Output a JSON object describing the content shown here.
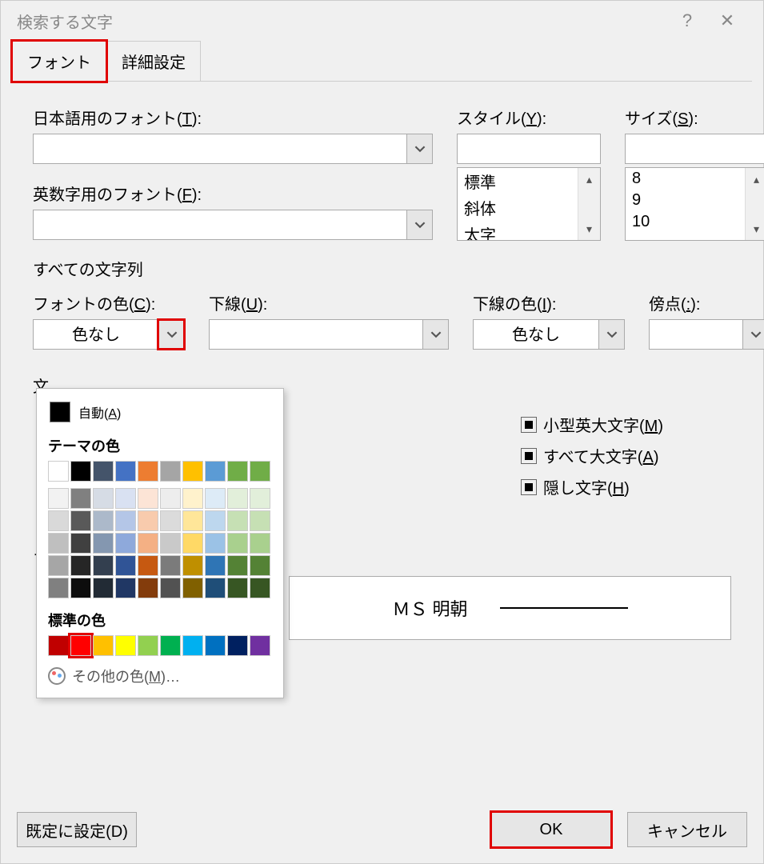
{
  "title": "検索する文字",
  "tabs": {
    "font": "フォント",
    "advanced": "詳細設定"
  },
  "labels": {
    "jp_font": "日本語用のフォント(",
    "jp_font_key": "T",
    "en_font": "英数字用のフォント(",
    "en_font_key": "F",
    "style": "スタイル(",
    "style_key": "Y",
    "size": "サイズ(",
    "size_key": "S",
    "all_text": "すべての文字列",
    "font_color": "フォントの色(",
    "font_color_key": "C",
    "underline": "下線(",
    "underline_key": "U",
    "underline_color": "下線の色(",
    "underline_color_key": "I",
    "emphasis": "傍点(",
    "emphasis_key": ":",
    "effects": "文",
    "preview": "プ",
    "close_paren": "):"
  },
  "values": {
    "font_color": "色なし",
    "underline_color": "色なし"
  },
  "style_list": [
    "標準",
    "斜体",
    "太字"
  ],
  "size_list": [
    "8",
    "9",
    "10"
  ],
  "checkboxes": {
    "small_caps": "小型英大文字(",
    "small_caps_key": "M",
    "all_caps": "すべて大文字(",
    "all_caps_key": "A",
    "hidden": "隠し文字(",
    "hidden_key": "H",
    "close": ")"
  },
  "preview_text": "ＭＳ 明朝",
  "buttons": {
    "set_default": "既定に設定(D)",
    "ok": "OK",
    "cancel": "キャンセル"
  },
  "color_popup": {
    "auto": "自動(",
    "auto_key": "A",
    "auto_close": ")",
    "theme": "テーマの色",
    "standard": "標準の色",
    "more": "その他の色(",
    "more_key": "M",
    "more_close": ")…",
    "theme_row": [
      "#ffffff",
      "#000000",
      "#44546a",
      "#4472c4",
      "#ed7d31",
      "#a5a5a5",
      "#ffc000",
      "#5b9bd5",
      "#70ad47",
      "#70ad47"
    ],
    "theme_tints": [
      [
        "#f2f2f2",
        "#808080",
        "#d6dce5",
        "#d9e1f2",
        "#fce4d6",
        "#ededed",
        "#fff2cc",
        "#ddebf7",
        "#e2efda",
        "#e2efda"
      ],
      [
        "#d9d9d9",
        "#595959",
        "#acb9ca",
        "#b4c6e7",
        "#f8cbad",
        "#dbdbdb",
        "#ffe699",
        "#bdd7ee",
        "#c6e0b4",
        "#c6e0b4"
      ],
      [
        "#bfbfbf",
        "#404040",
        "#8497b0",
        "#8ea9db",
        "#f4b084",
        "#c9c9c9",
        "#ffd966",
        "#9bc2e6",
        "#a9d08e",
        "#a9d08e"
      ],
      [
        "#a6a6a6",
        "#262626",
        "#333f4f",
        "#305496",
        "#c65911",
        "#7b7b7b",
        "#bf8f00",
        "#2f75b5",
        "#548235",
        "#548235"
      ],
      [
        "#808080",
        "#0d0d0d",
        "#222b35",
        "#203764",
        "#833c0c",
        "#525252",
        "#806000",
        "#1f4e78",
        "#375623",
        "#375623"
      ]
    ],
    "standard_colors": [
      "#c00000",
      "#ff0000",
      "#ffc000",
      "#ffff00",
      "#92d050",
      "#00b050",
      "#00b0f0",
      "#0070c0",
      "#002060",
      "#7030a0"
    ]
  }
}
